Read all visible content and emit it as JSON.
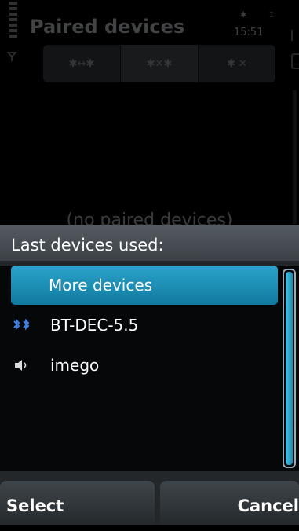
{
  "header": {
    "title": "Paired devices",
    "clock": "15:51",
    "toolbar": {
      "segments": [
        "✱↔✱",
        "✱✕✱",
        "✱ ✕"
      ]
    },
    "empty_text": "(no paired devices)"
  },
  "popup": {
    "heading": "Last devices used:",
    "items": [
      {
        "label": "More devices",
        "icon": "",
        "selected": true
      },
      {
        "label": "BT-DEC-5.5",
        "icon": "bluetooth-pair-icon"
      },
      {
        "label": "imego",
        "icon": "speaker-icon"
      }
    ],
    "scroll_fraction": 1.0
  },
  "softkeys": {
    "left": "Select",
    "right": "Cancel"
  },
  "colors": {
    "accent": "#1f93bd",
    "background": "#000000"
  }
}
